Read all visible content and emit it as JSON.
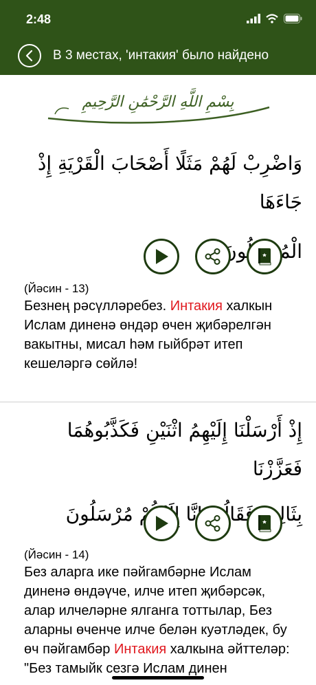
{
  "status": {
    "time": "2:48"
  },
  "nav": {
    "title": "В 3 местах, 'интакия' было найдено"
  },
  "bismillah": "بِسْمِ اللَّهِ الرَّحْمَٰنِ الرَّحِيمِ",
  "verses": [
    {
      "arabic_line1": "وَاضْرِبْ لَهُمْ مَثَلًا أَصْحَابَ الْقَرْيَةِ إِذْ جَاءَهَا",
      "arabic_line2": "الْمُرْسَلُونَ",
      "ref": "(Йәсин - 13)",
      "text_before": "Безнең рәсүлләребез. ",
      "highlight": "Интакия",
      "text_after": " халкын Ислам диненә өндәр өчен җибәрелгән вакытны, мисал һәм гыйбрәт итеп кешеләргә сөйлә!"
    },
    {
      "arabic_line1": "إِذْ أَرْسَلْنَا إِلَيْهِمُ اثْنَيْنِ فَكَذَّبُوهُمَا فَعَزَّزْنَا",
      "arabic_line2": "بِثَالِثٍ فَقَالُوا إِنَّا إِلَيْكُمْ مُرْسَلُونَ",
      "ref": "(Йәсин - 14)",
      "text_before": "Без аларга ике пәйгамбәрне Ислам диненә өндәүче, илче итеп җибәрсәк, алар илчеләрне ялганга тоттылар, Без аларны өченче илче белән куәтләдек, бу өч пәйгамбәр ",
      "highlight": "Интакия",
      "text_after": " халкына әйттеләр: \"Без тамыйк сезгә Ислам динен"
    }
  ],
  "icons": [
    "back-chevron-icon",
    "play-icon",
    "share-icon",
    "quran-book-icon",
    "signal-icon",
    "wifi-icon",
    "battery-icon"
  ],
  "colors": {
    "header": "#2f5318",
    "icon": "#1e3b10",
    "highlight": "#e0181e"
  }
}
